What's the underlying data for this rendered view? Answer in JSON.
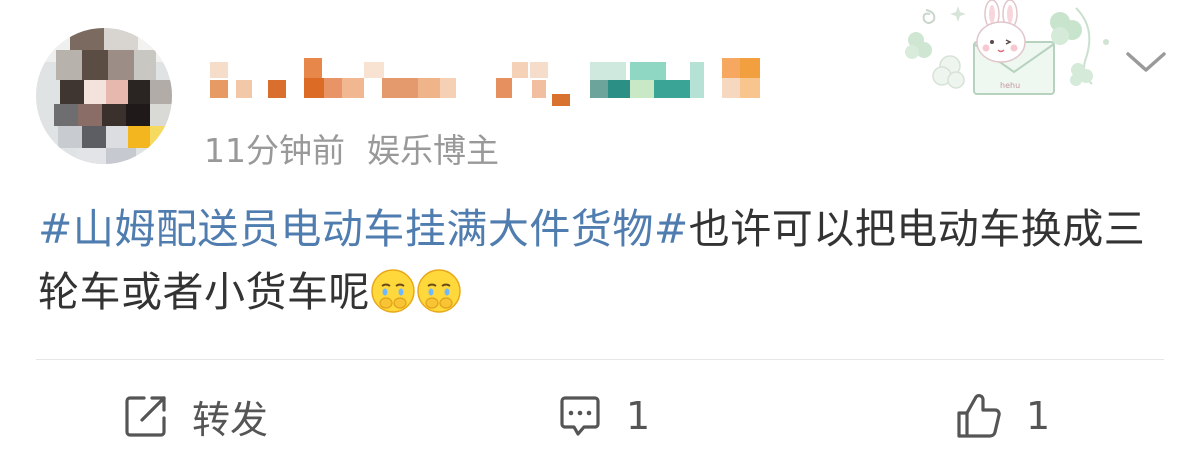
{
  "post": {
    "time": "11分钟前",
    "author_tag": "娱乐博主",
    "hashtag": "#山姆配送员电动车挂满大件货物#",
    "text": "也许可以把电动车换成三轮车或者小货车呢"
  },
  "emojis": [
    "crying-face-emoji",
    "crying-face-emoji"
  ],
  "actions": {
    "repost_label": "转发",
    "comment_count": "1",
    "like_count": "1"
  },
  "colors": {
    "hashtag": "#507daf",
    "body_text": "#333333",
    "meta_text": "#999999",
    "action_text": "#555555",
    "divider": "#e6e6e6"
  },
  "sticker_text": "hehu"
}
